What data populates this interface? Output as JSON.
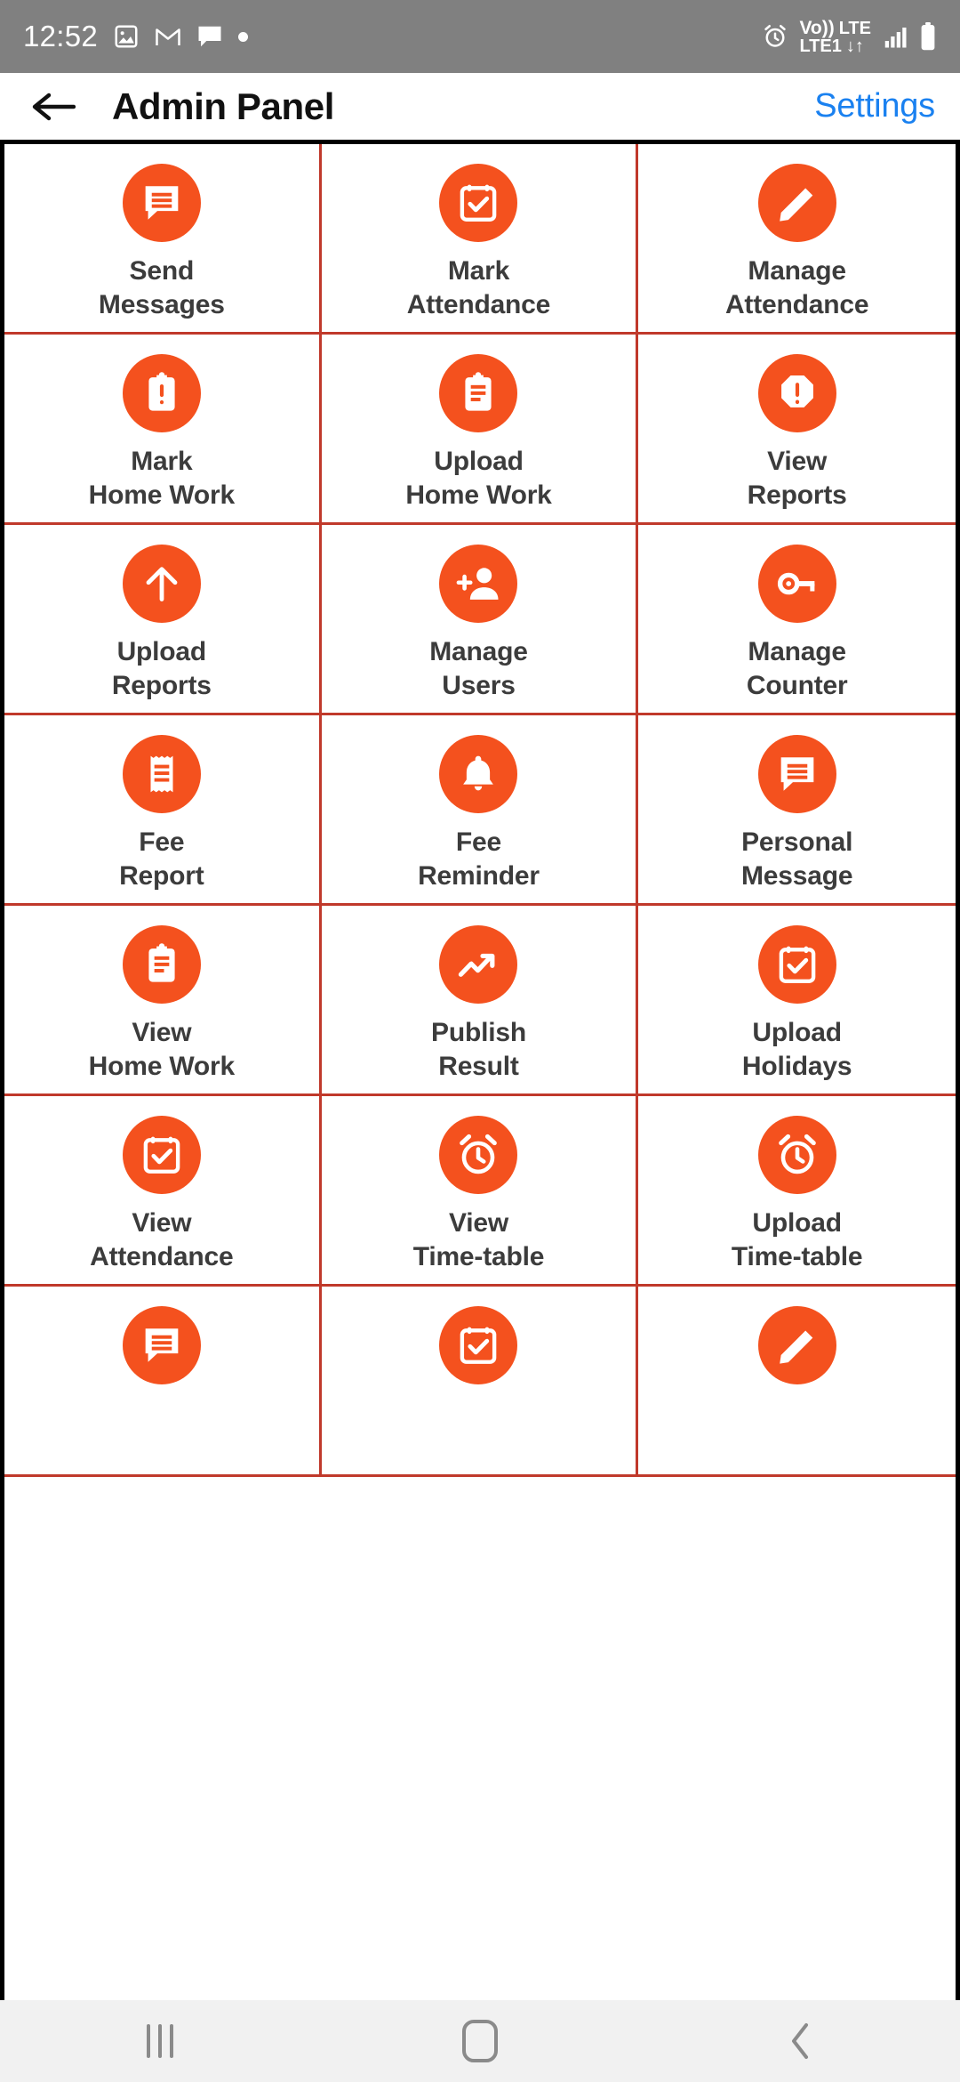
{
  "status_bar": {
    "time": "12:52",
    "left_icons": [
      "gallery-icon",
      "gmail-icon",
      "messages-icon",
      "dot-icon"
    ],
    "right": {
      "alarm": "alarm-icon",
      "volte_line1": "Vo))",
      "volte_line2": "LTE1",
      "volte_arrows": "↓↑",
      "network": "LTE",
      "signal": "signal-bars-icon",
      "battery": "battery-icon"
    },
    "background_color": "#808080"
  },
  "header": {
    "back_label": "back-arrow",
    "title": "Admin Panel",
    "settings_label": "Settings",
    "settings_color": "#1a81f0"
  },
  "theme": {
    "icon_circle_color": "#f4511e",
    "cell_border_color": "#c0392b",
    "grid_outer_border_color": "#000000",
    "label_color": "#3c3c3c"
  },
  "grid": {
    "columns": 3,
    "items": [
      {
        "label": "Send\nMessages",
        "icon": "chat-bubble-lines-icon"
      },
      {
        "label": "Mark\nAttendance",
        "icon": "calendar-check-icon"
      },
      {
        "label": "Manage\nAttendance",
        "icon": "pencil-edit-icon"
      },
      {
        "label": "Mark\nHome Work",
        "icon": "clipboard-exclamation-icon"
      },
      {
        "label": "Upload\nHome Work",
        "icon": "clipboard-lines-icon"
      },
      {
        "label": "View\nReports",
        "icon": "octagon-exclamation-icon"
      },
      {
        "label": "Upload\nReports",
        "icon": "arrow-up-icon"
      },
      {
        "label": "Manage\nUsers",
        "icon": "person-add-icon"
      },
      {
        "label": "Manage\nCounter",
        "icon": "key-icon"
      },
      {
        "label": "Fee\nReport",
        "icon": "receipt-icon"
      },
      {
        "label": "Fee\nReminder",
        "icon": "bell-icon"
      },
      {
        "label": "Personal\nMessage",
        "icon": "chat-bubble-lines-icon"
      },
      {
        "label": "View\nHome Work",
        "icon": "clipboard-lines-icon"
      },
      {
        "label": "Publish\nResult",
        "icon": "trending-up-icon"
      },
      {
        "label": "Upload\nHolidays",
        "icon": "calendar-check-icon"
      },
      {
        "label": "View\nAttendance",
        "icon": "calendar-check-icon"
      },
      {
        "label": "View\nTime-table",
        "icon": "alarm-clock-icon"
      },
      {
        "label": "Upload\nTime-table",
        "icon": "alarm-clock-icon"
      },
      {
        "label": "",
        "icon": "chat-bubble-lines-icon"
      },
      {
        "label": "",
        "icon": "calendar-check-icon"
      },
      {
        "label": "",
        "icon": "pencil-edit-icon"
      }
    ]
  },
  "nav_bar": {
    "recents_label": "recents-button",
    "home_label": "home-button",
    "back_label": "back-button",
    "background_color": "#f1f1f1"
  }
}
